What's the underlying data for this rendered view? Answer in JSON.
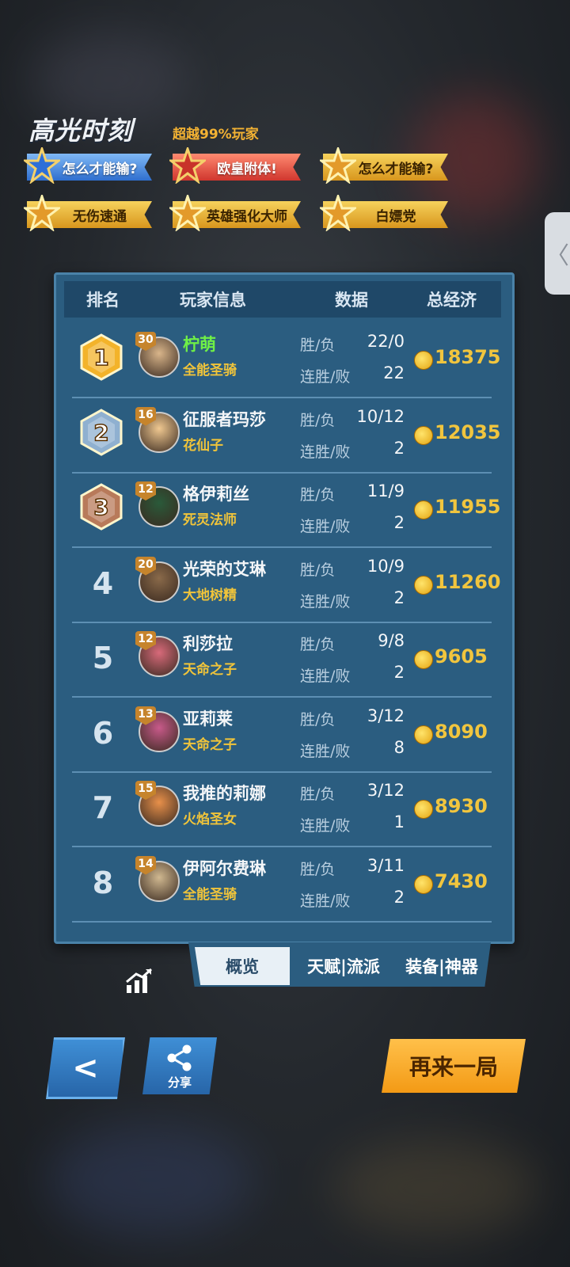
{
  "highlight": {
    "title": "高光时刻",
    "subtitle": "超越99%玩家",
    "badges": [
      {
        "label": "怎么才能输?",
        "style": "blue"
      },
      {
        "label": "欧皇附体!",
        "style": "red"
      },
      {
        "label": "怎么才能输?",
        "style": "gold"
      },
      {
        "label": "无伤速通",
        "style": "gold"
      },
      {
        "label": "英雄强化大师",
        "style": "gold"
      },
      {
        "label": "白嫖党",
        "style": "gold"
      }
    ]
  },
  "table": {
    "headers": {
      "rank": "排名",
      "player": "玩家信息",
      "data": "数据",
      "economy": "总经济"
    },
    "stat_labels": {
      "win_loss": "胜/负",
      "streak": "连胜/败"
    },
    "rows": [
      {
        "rank": "1",
        "level": "30",
        "name": "柠萌",
        "class": "全能圣骑",
        "win_loss": "22/0",
        "streak": "22",
        "gold": "18375"
      },
      {
        "rank": "2",
        "level": "16",
        "name": "征服者玛莎",
        "class": "花仙子",
        "win_loss": "10/12",
        "streak": "2",
        "gold": "12035"
      },
      {
        "rank": "3",
        "level": "12",
        "name": "格伊莉丝",
        "class": "死灵法师",
        "win_loss": "11/9",
        "streak": "2",
        "gold": "11955"
      },
      {
        "rank": "4",
        "level": "20",
        "name": "光荣的艾琳",
        "class": "大地树精",
        "win_loss": "10/9",
        "streak": "2",
        "gold": "11260"
      },
      {
        "rank": "5",
        "level": "12",
        "name": "利莎拉",
        "class": "天命之子",
        "win_loss": "9/8",
        "streak": "2",
        "gold": "9605"
      },
      {
        "rank": "6",
        "level": "13",
        "name": "亚莉莱",
        "class": "天命之子",
        "win_loss": "3/12",
        "streak": "8",
        "gold": "8090"
      },
      {
        "rank": "7",
        "level": "15",
        "name": "我推的莉娜",
        "class": "火焰圣女",
        "win_loss": "3/12",
        "streak": "1",
        "gold": "8930"
      },
      {
        "rank": "8",
        "level": "14",
        "name": "伊阿尔费琳",
        "class": "全能圣骑",
        "win_loss": "3/11",
        "streak": "2",
        "gold": "7430"
      }
    ]
  },
  "tabs": [
    "概览",
    "天赋|流派",
    "装备|神器"
  ],
  "buttons": {
    "share": "分享",
    "play_again": "再来一局",
    "back_glyph": "<",
    "side_glyph": "〈"
  },
  "colors": {
    "panel": "#2b5d80",
    "gold_text": "#f1c53e",
    "first_name": "#6ff046",
    "play_again": "#f39a15"
  }
}
